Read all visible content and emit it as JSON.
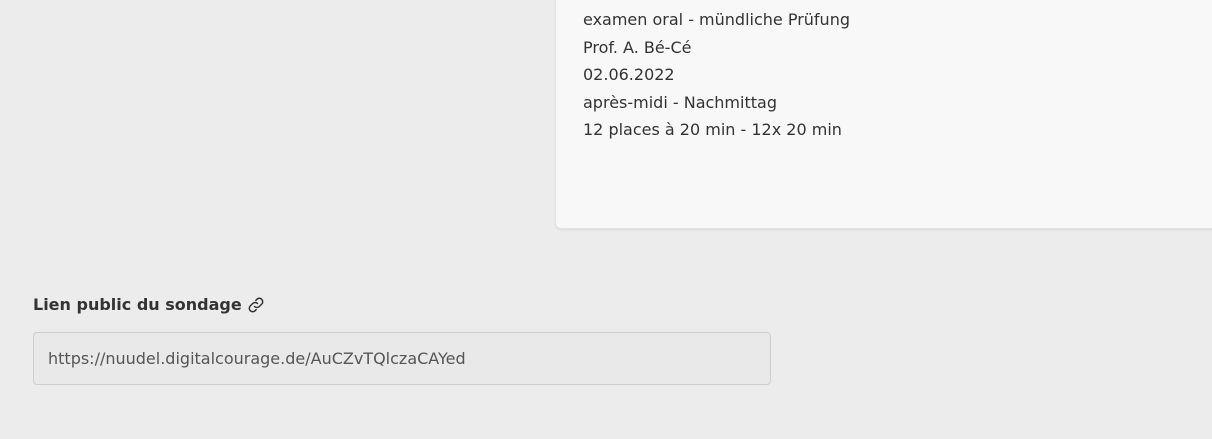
{
  "poll_description": {
    "lines": [
      "examen oral - mündliche Prüfung",
      "Prof. A. Bé-Cé",
      "02.06.2022",
      "après-midi - Nachmittag",
      "12 places à 20 min - 12x 20 min"
    ]
  },
  "public_link": {
    "label": "Lien public du sondage",
    "icon": "link-icon",
    "value": "https://nuudel.digitalcourage.de/AuCZvTQlczaCAYed"
  },
  "colors": {
    "page_background": "#ececec",
    "card_background": "#f8f8f8",
    "text": "#333333",
    "input_background": "#e9e9e9",
    "input_border": "#cdcdcd"
  }
}
